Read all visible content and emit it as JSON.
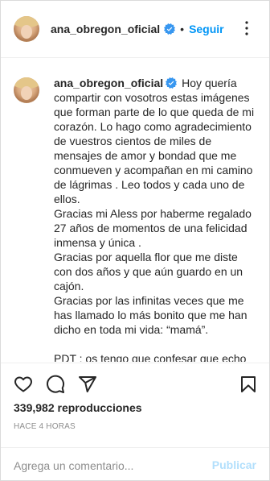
{
  "post": {
    "username": "ana_obregon_oficial",
    "verified": true,
    "separator": "•",
    "follow_label": "Seguir"
  },
  "caption": {
    "username": "ana_obregon_oficial",
    "paragraphs": [
      "Hoy quería compartir con vosotros estas imágenes que forman parte de lo que queda de mi corazón. Lo hago como agradecimiento de vuestros cientos de miles de mensajes de amor y bondad que me conmueven y acompañan en mi camino de lágrimas . Leo todos y cada uno de ellos.",
      "Gracias mi Aless por haberme regalado 27 años de momentos de una felicidad inmensa y única .",
      "Gracias por aquella flor que me diste con dos años y que aún guardo en un cajón.",
      "Gracias por las infinitas veces que me has llamado lo más bonito que me han dicho en toda mi vida: “mamá”.",
      "",
      "PDT : os tengo que confesar que echo"
    ]
  },
  "stats": {
    "views": "339,982 reproducciones",
    "time": "HACE 4 HORAS"
  },
  "comment": {
    "placeholder": "Agrega un comentario...",
    "publish_label": "Publicar"
  },
  "colors": {
    "accent": "#0095f6",
    "publish_disabled": "#b2dffc",
    "muted": "#8e8e8e",
    "text": "#262626",
    "border": "#dbdbdb"
  },
  "icons": {
    "verified": "verified-badge-icon",
    "more": "more-options-icon",
    "like": "heart-icon",
    "comment": "comment-icon",
    "share": "share-icon",
    "save": "bookmark-icon"
  }
}
